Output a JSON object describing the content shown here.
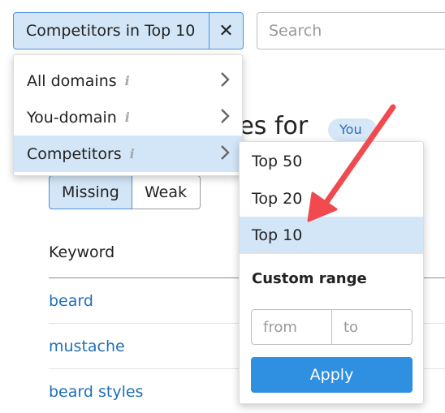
{
  "filter_chip": {
    "label": "Competitors in Top 10",
    "clear_icon": "✕"
  },
  "search": {
    "placeholder": "Search"
  },
  "page": {
    "title_partial": "ies for",
    "badge": "You",
    "tabs": [
      {
        "label": "Missing",
        "active": true
      },
      {
        "label": "Weak",
        "active": false
      }
    ],
    "table": {
      "column_header": "Keyword",
      "rows": [
        "beard",
        "mustache",
        "beard styles"
      ]
    }
  },
  "dropdown": {
    "items": [
      {
        "label": "All domains",
        "info": "i",
        "active": false
      },
      {
        "label": "You-domain",
        "info": "i",
        "active": false
      },
      {
        "label": "Competitors",
        "info": "i",
        "active": true
      }
    ]
  },
  "submenu": {
    "options": [
      {
        "label": "Top 50",
        "active": false
      },
      {
        "label": "Top 20",
        "active": false
      },
      {
        "label": "Top 10",
        "active": true
      }
    ],
    "custom_range_title": "Custom range",
    "from_placeholder": "from",
    "to_placeholder": "to",
    "apply_label": "Apply"
  },
  "colors": {
    "accent": "#2f8fe0",
    "selected_bg": "#d3e6f7",
    "link": "#1f6fb8",
    "annotation_arrow": "#f04a4f"
  }
}
